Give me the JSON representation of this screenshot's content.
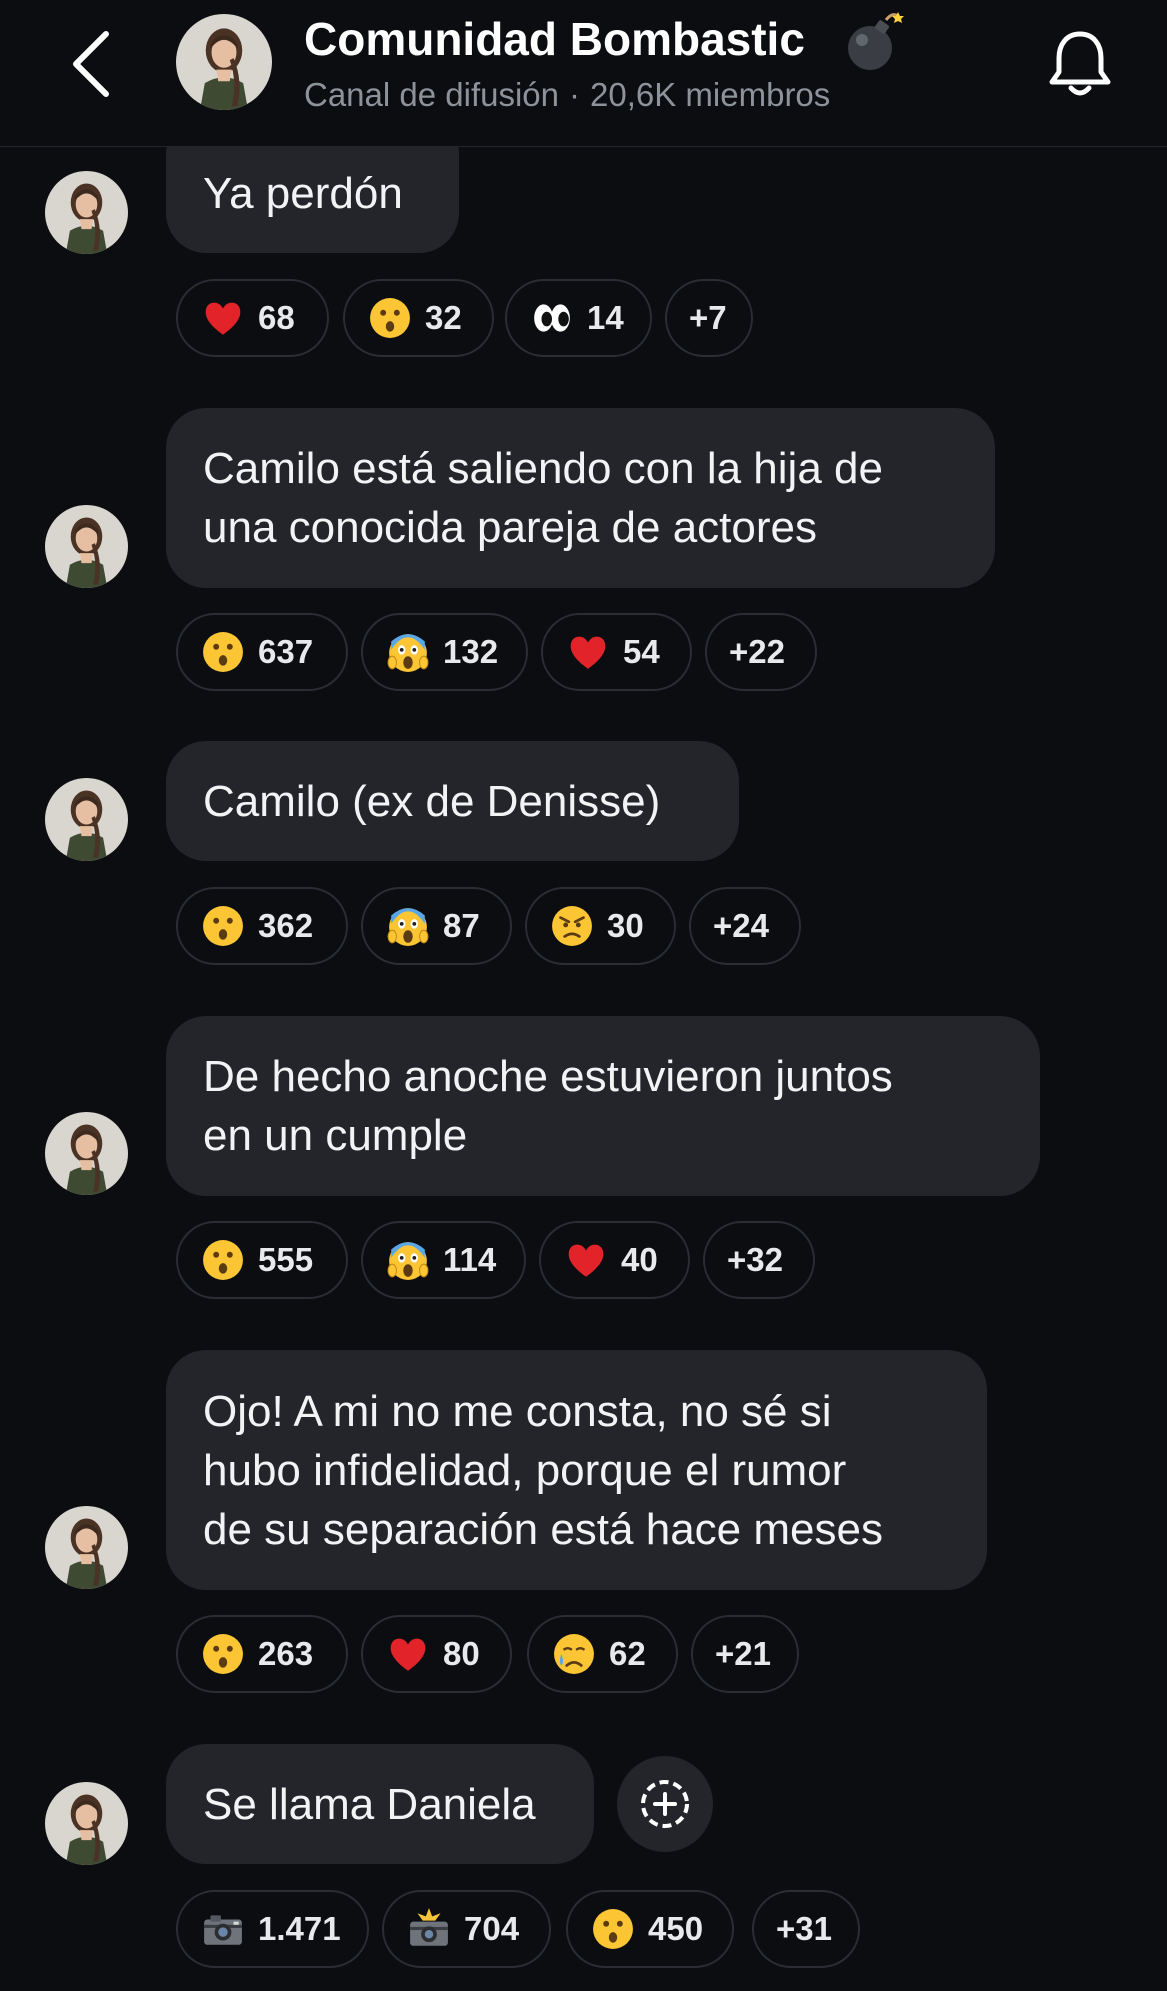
{
  "header": {
    "title": "Comunidad Bombastic",
    "title_emoji": "bomb-icon",
    "subtitle_type": "Canal de difusión",
    "subtitle_sep": "·",
    "subtitle_members": "20,6K miembros"
  },
  "messages": [
    {
      "lines": [
        "Ya perdón"
      ],
      "reactions": [
        {
          "icon": "heart",
          "count": "68"
        },
        {
          "icon": "surprised",
          "count": "32"
        },
        {
          "icon": "eyes",
          "count": "14"
        },
        {
          "icon": "more",
          "count": "+7"
        }
      ]
    },
    {
      "lines": [
        "Camilo está saliendo con la hija de",
        "una conocida pareja de actores"
      ],
      "reactions": [
        {
          "icon": "surprised",
          "count": "637"
        },
        {
          "icon": "scream",
          "count": "132"
        },
        {
          "icon": "heart",
          "count": "54"
        },
        {
          "icon": "more",
          "count": "+22"
        }
      ]
    },
    {
      "lines": [
        "Camilo (ex de Denisse)"
      ],
      "reactions": [
        {
          "icon": "surprised",
          "count": "362"
        },
        {
          "icon": "scream",
          "count": "87"
        },
        {
          "icon": "angry",
          "count": "30"
        },
        {
          "icon": "more",
          "count": "+24"
        }
      ]
    },
    {
      "lines": [
        "De hecho anoche  estuvieron juntos",
        "en un cumple"
      ],
      "reactions": [
        {
          "icon": "surprised",
          "count": "555"
        },
        {
          "icon": "scream",
          "count": "114"
        },
        {
          "icon": "heart",
          "count": "40"
        },
        {
          "icon": "more",
          "count": "+32"
        }
      ]
    },
    {
      "lines": [
        "Ojo! A mi no me consta, no sé si",
        "hubo infidelidad, porque el rumor",
        "de su separación está hace meses"
      ],
      "reactions": [
        {
          "icon": "surprised",
          "count": "263"
        },
        {
          "icon": "heart",
          "count": "80"
        },
        {
          "icon": "crying",
          "count": "62"
        },
        {
          "icon": "more",
          "count": "+21"
        }
      ]
    },
    {
      "lines": [
        "Se llama Daniela"
      ],
      "reactions": [
        {
          "icon": "camera",
          "count": "1.471"
        },
        {
          "icon": "camera-flash",
          "count": "704"
        },
        {
          "icon": "surprised",
          "count": "450"
        },
        {
          "icon": "more",
          "count": "+31"
        }
      ]
    }
  ],
  "colors": {
    "background": "#0b0d11",
    "bubble": "#23252b",
    "pill_border": "#2a2d33",
    "subtitle": "#8e939b"
  }
}
